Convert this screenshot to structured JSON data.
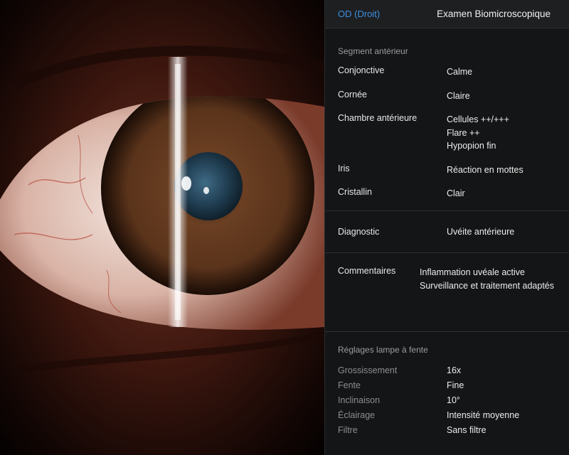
{
  "header": {
    "eye_tab": "OD (Droit)",
    "title": "Examen Biomicroscopique"
  },
  "anterior_segment": {
    "title": "Segment antérieur",
    "rows": [
      {
        "label": "Conjonctive",
        "values": [
          "Calme"
        ]
      },
      {
        "label": "Cornée",
        "values": [
          "Claire"
        ]
      },
      {
        "label": "Chambre antérieure",
        "values": [
          "Cellules ++/+++",
          "Flare ++",
          "Hypopion fin"
        ]
      },
      {
        "label": "Iris",
        "values": [
          "Réaction en mottes"
        ]
      },
      {
        "label": "Cristallin",
        "values": [
          "Clair"
        ]
      }
    ]
  },
  "diagnosis": {
    "label": "Diagnostic",
    "value": "Uvéite antérieure"
  },
  "comments": {
    "label": "Commentaires",
    "lines": [
      "Inflammation uvéale active",
      "Surveillance et traitement adaptés"
    ]
  },
  "slit_lamp": {
    "title": "Réglages lampe à fente",
    "rows": [
      {
        "label": "Grossissement",
        "value": "16x"
      },
      {
        "label": "Fente",
        "value": "Fine"
      },
      {
        "label": "Inclinaison",
        "value": "10°"
      },
      {
        "label": "Éclairage",
        "value": "Intensité moyenne"
      },
      {
        "label": "Filtre",
        "value": "Sans filtre"
      }
    ]
  },
  "colors": {
    "accent": "#3d8fe0",
    "diagnosis": "#f1d97a",
    "panel_bg": "#141516"
  }
}
